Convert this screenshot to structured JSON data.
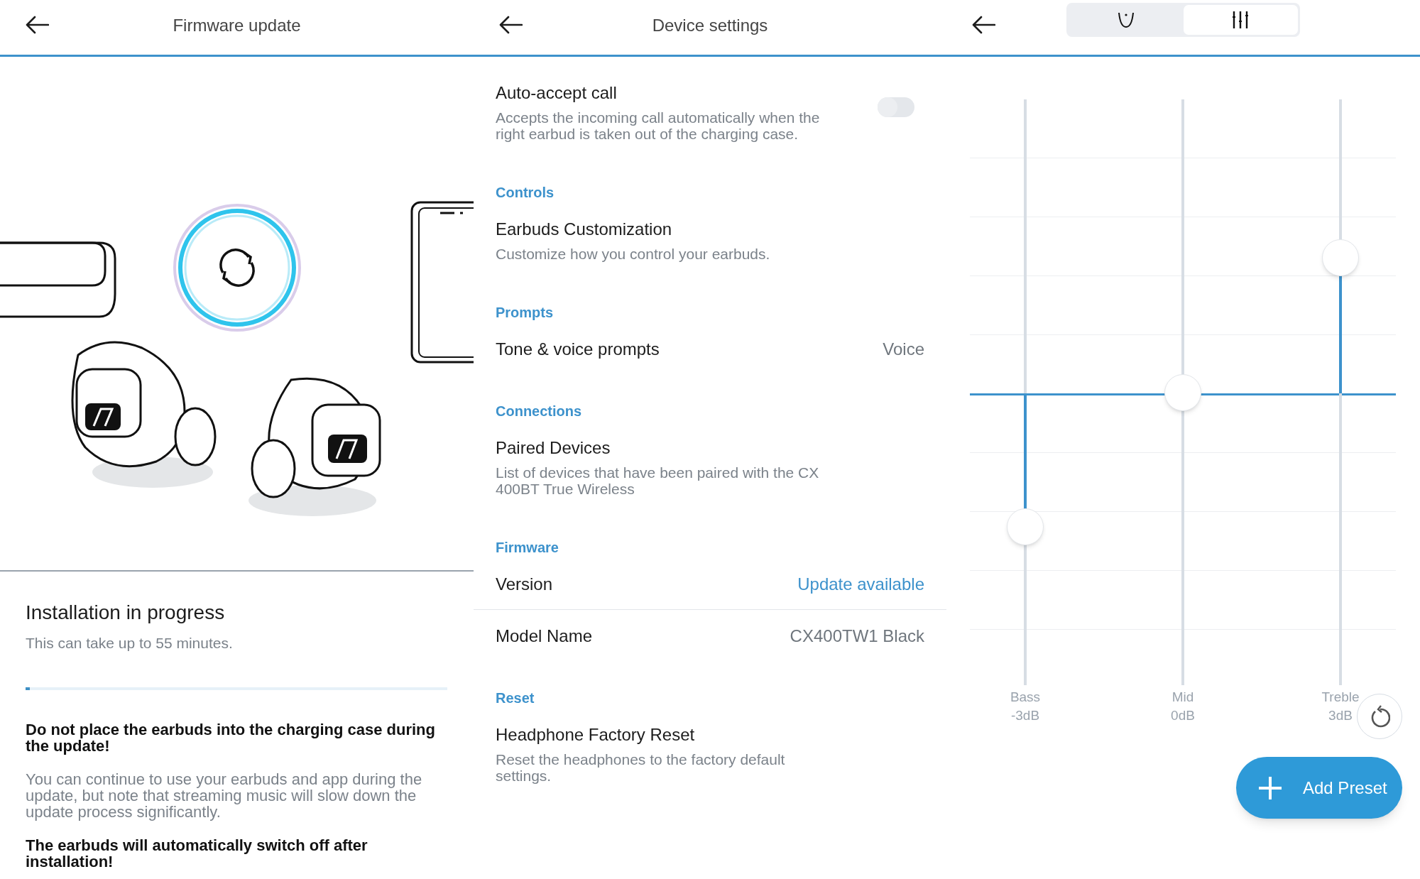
{
  "firmware_screen": {
    "title": "Firmware update",
    "heading": "Installation in progress",
    "subtitle": "This can take up to 55 minutes.",
    "progress": {
      "level": 0.01
    },
    "notes": [
      {
        "kind": "warning",
        "text": "Do not place the earbuds into the charging case during the update!"
      },
      {
        "kind": "info",
        "text": "You can continue to use your earbuds and app during the update, but note that streaming music will slow down the update process significantly."
      },
      {
        "kind": "warning",
        "text": "The earbuds will automatically switch off after installation!"
      }
    ]
  },
  "settings_screen": {
    "title": "Device settings",
    "sections": [
      {
        "items": [
          {
            "kind": "toggle",
            "title": "Auto-accept call",
            "description": "Accepts the incoming call automatically when the right earbud is taken out of the charging case.",
            "on": false
          }
        ]
      },
      {
        "header": "Controls",
        "items": [
          {
            "kind": "link",
            "title": "Earbuds Customization",
            "description": "Customize how you control your earbuds."
          }
        ]
      },
      {
        "header": "Prompts",
        "items": [
          {
            "kind": "value",
            "title": "Tone & voice prompts",
            "value": "Voice",
            "highlighted": false
          }
        ]
      },
      {
        "header": "Connections",
        "items": [
          {
            "kind": "link",
            "title": "Paired Devices",
            "description": "List of devices that have been paired with the CX 400BT True Wireless"
          }
        ]
      },
      {
        "header": "Firmware",
        "items": [
          {
            "kind": "value",
            "title": "Version",
            "value": "Update available",
            "highlighted": true
          },
          {
            "kind": "value",
            "title": "Model Name",
            "value": "CX400TW1 Black",
            "highlighted": false
          }
        ]
      },
      {
        "header": "Reset",
        "items": [
          {
            "kind": "link",
            "title": "Headphone Factory Reset",
            "description": "Reset the headphones to the factory default settings."
          }
        ]
      }
    ]
  },
  "equalizer_screen": {
    "tabs": [
      {
        "kind": "curve",
        "selected": false
      },
      {
        "kind": "sliders",
        "selected": true
      }
    ],
    "bands": [
      {
        "name": "Bass",
        "reading": "-3dB",
        "level": 0.27
      },
      {
        "name": "Mid",
        "reading": "0dB",
        "level": 0.5
      },
      {
        "name": "Treble",
        "reading": "3dB",
        "level": 0.73
      }
    ],
    "add_preset": "Add Preset"
  }
}
